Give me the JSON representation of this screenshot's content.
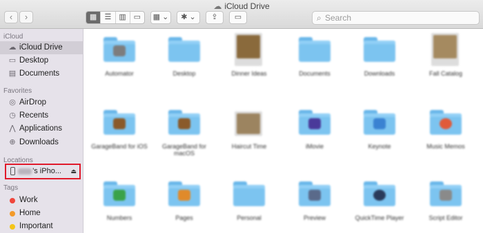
{
  "window": {
    "title": "iCloud Drive",
    "title_icon": "cloud-icon"
  },
  "toolbar": {
    "back_icon": "‹",
    "forward_icon": "›",
    "view_icons": [
      "▦",
      "☰",
      "▥",
      "▭"
    ],
    "group_label": "▦ ⌄",
    "action_label": "✱ ⌄",
    "share_label": "⇪",
    "tag_label": "▭"
  },
  "search": {
    "placeholder": "Search",
    "value": ""
  },
  "sidebar": {
    "sections": {
      "icloud": "iCloud",
      "favorites": "Favorites",
      "locations": "Locations",
      "tags": "Tags"
    },
    "icloud_items": [
      {
        "label": "iCloud Drive",
        "icon": "☁",
        "selected": true
      },
      {
        "label": "Desktop",
        "icon": "▭"
      },
      {
        "label": "Documents",
        "icon": "▤"
      }
    ],
    "favorites_items": [
      {
        "label": "AirDrop",
        "icon": "◎"
      },
      {
        "label": "Recents",
        "icon": "◷"
      },
      {
        "label": "Applications",
        "icon": "⋀"
      },
      {
        "label": "Downloads",
        "icon": "⊕"
      }
    ],
    "device": {
      "label": "’s iPho...",
      "eject": "⏏"
    },
    "tags": [
      {
        "label": "Work",
        "color": "#f0463c"
      },
      {
        "label": "Home",
        "color": "#f39a2a"
      },
      {
        "label": "Important",
        "color": "#f4c518"
      }
    ]
  },
  "files": {
    "row1": [
      "Automator",
      "Desktop",
      "Dinner Ideas",
      "Documents",
      "Downloads",
      "Fall Catalog"
    ],
    "row2": [
      "GarageBand for iOS",
      "GarageBand for macOS",
      "Haircut Time",
      "iMovie",
      "Keynote",
      "Music Memos"
    ],
    "row3": [
      "Numbers",
      "Pages",
      "Personal",
      "Preview",
      "QuickTime Player",
      "Script Editor"
    ]
  },
  "colors": {
    "accent": "#7cc4f0",
    "highlight_box": "#e0192a",
    "sidebar_bg": "#e6e2ea"
  }
}
